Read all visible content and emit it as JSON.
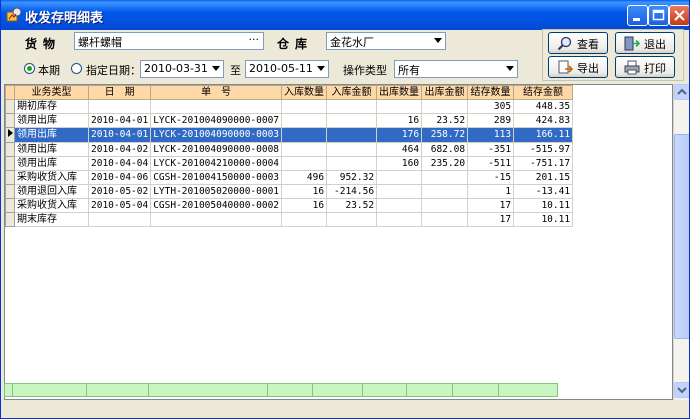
{
  "window": {
    "title": "收发存明细表"
  },
  "filters": {
    "goods_label": "货物",
    "goods_value": "螺杆螺帽",
    "goods_browse": "···",
    "warehouse_label": "仓库",
    "warehouse_value": "金花水厂",
    "period_option": "本期",
    "date_option": "指定日期：",
    "date_from": "2010-03-31",
    "date_to_label": "至",
    "date_to": "2010-05-11",
    "op_type_label": "操作类型",
    "op_type_value": "所有"
  },
  "buttons": {
    "query": "查看",
    "exit": "退出",
    "export": "导出",
    "print": "打印"
  },
  "table": {
    "headers": [
      "业务类型",
      "日　期",
      "单　号",
      "入库数量",
      "入库金额",
      "出库数量",
      "出库金额",
      "结存数量",
      "结存金额"
    ],
    "rows": [
      [
        "期初库存",
        "",
        "",
        "",
        "",
        "",
        "",
        "305",
        "448.35"
      ],
      [
        "领用出库",
        "2010-04-01",
        "LYCK-201004090000-0007",
        "",
        "",
        "16",
        "23.52",
        "289",
        "424.83"
      ],
      [
        "领用出库",
        "2010-04-01",
        "LYCK-201004090000-0003",
        "",
        "",
        "176",
        "258.72",
        "113",
        "166.11"
      ],
      [
        "领用出库",
        "2010-04-02",
        "LYCK-201004090000-0008",
        "",
        "",
        "464",
        "682.08",
        "-351",
        "-515.97"
      ],
      [
        "领用出库",
        "2010-04-04",
        "LYCK-201004210000-0004",
        "",
        "",
        "160",
        "235.20",
        "-511",
        "-751.17"
      ],
      [
        "采购收货入库",
        "2010-04-06",
        "CGSH-201004150000-0003",
        "496",
        "952.32",
        "",
        "",
        "-15",
        "201.15"
      ],
      [
        "领用退回入库",
        "2010-05-02",
        "LYTH-201005020000-0001",
        "16",
        "-214.56",
        "",
        "",
        "1",
        "-13.41"
      ],
      [
        "采购收货入库",
        "2010-05-04",
        "CGSH-201005040000-0002",
        "16",
        "23.52",
        "",
        "",
        "17",
        "10.11"
      ],
      [
        "期末库存",
        "",
        "",
        "",
        "",
        "",
        "",
        "17",
        "10.11"
      ]
    ],
    "selected_row": 2
  }
}
